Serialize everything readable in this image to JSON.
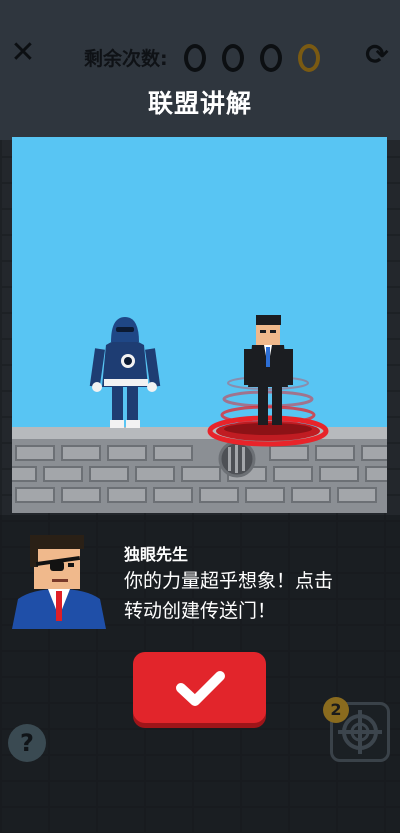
{
  "header": {
    "close_icon": "close-icon",
    "attempts_label": "剩余次数:",
    "attempts_total": 4,
    "attempts_used_style": [
      "dark",
      "dark",
      "dark",
      "gold"
    ],
    "refresh_icon": "refresh-icon",
    "title": "联盟讲解"
  },
  "dialog": {
    "speaker": "独眼先生",
    "message_line1": "你的力量超乎想象！点击",
    "message_line2": "转动创建传送门！",
    "confirm_icon": "checkmark-icon"
  },
  "footer": {
    "help_label": "?",
    "scope_badge": "2",
    "scope_icon": "crosshair-icon"
  },
  "colors": {
    "sky": "#58c5f3",
    "confirm": "#e2252b",
    "portal": "#e8242a"
  }
}
